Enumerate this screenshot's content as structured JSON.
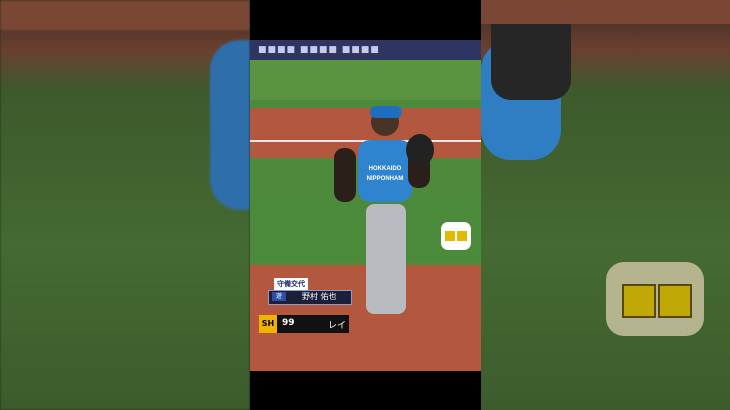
{
  "game": {
    "team_uniform_text": "HOKKAIDO NIPPONHAM",
    "substitution": {
      "title": "守備交代",
      "position": "遊",
      "player_name": "野村 佑也"
    },
    "batter": {
      "team_logo": "SH",
      "number": "99",
      "name_partial": "レイ"
    },
    "banner_text": "■■■■ ■■■■ ■■■■"
  },
  "colors": {
    "field_green": "#4d8a3c",
    "dirt": "#b4573f",
    "uniform_blue": "#2f84d0"
  },
  "icons": [
    "chat-emoji-bubble-icon",
    "team-logo-icon"
  ]
}
